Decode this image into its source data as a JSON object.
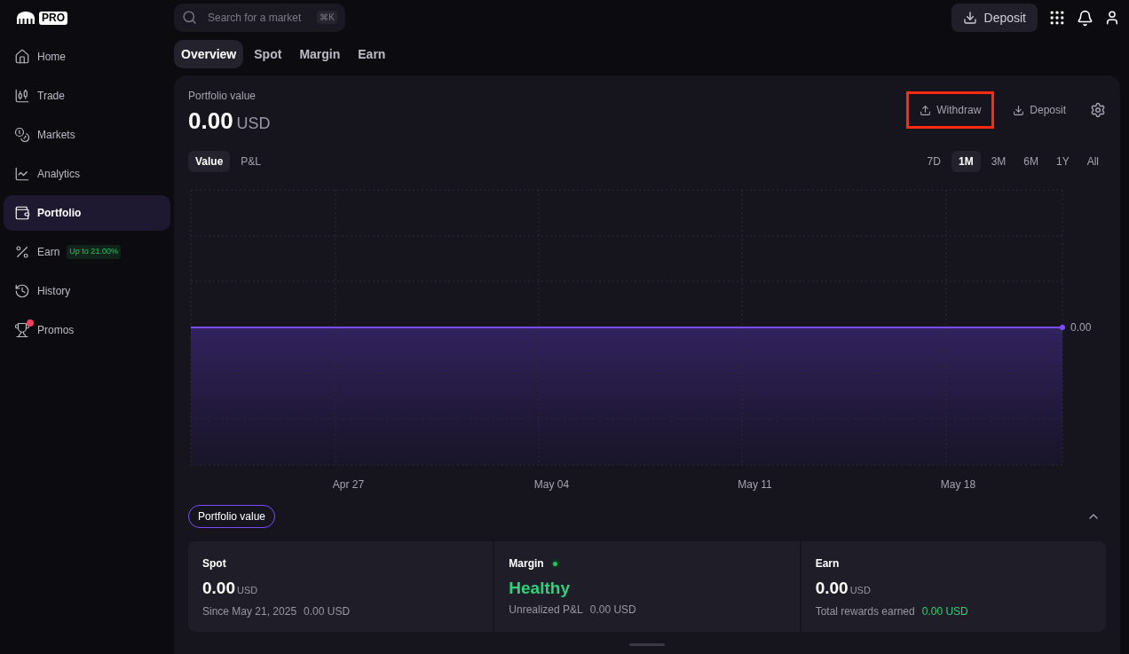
{
  "logo": {
    "badge": "PRO"
  },
  "sidebar": {
    "items": [
      {
        "label": "Home",
        "kind": "home",
        "selected": false,
        "notification": false
      },
      {
        "label": "Trade",
        "kind": "trade",
        "selected": false,
        "notification": false
      },
      {
        "label": "Markets",
        "kind": "markets",
        "selected": false,
        "notification": false
      },
      {
        "label": "Analytics",
        "kind": "analytics",
        "selected": false,
        "notification": false
      },
      {
        "label": "Portfolio",
        "kind": "portfolio",
        "selected": true,
        "notification": false
      },
      {
        "label": "Earn",
        "kind": "earn",
        "selected": false,
        "notification": false,
        "badge": "Up to 21.00%"
      },
      {
        "label": "History",
        "kind": "history",
        "selected": false,
        "notification": false
      },
      {
        "label": "Promos",
        "kind": "promos",
        "selected": false,
        "notification": true
      }
    ]
  },
  "topbar": {
    "search": {
      "placeholder": "Search for a market",
      "shortcut": "⌘K"
    },
    "deposit": "Deposit"
  },
  "tabs": [
    {
      "label": "Overview",
      "selected": true
    },
    {
      "label": "Spot",
      "selected": false
    },
    {
      "label": "Margin",
      "selected": false
    },
    {
      "label": "Earn",
      "selected": false
    }
  ],
  "portfolio": {
    "label": "Portfolio value",
    "amount": "0.00",
    "currency": "USD",
    "actions": [
      {
        "label": "Withdraw",
        "kind": "withdraw",
        "highlighted": true
      },
      {
        "label": "Deposit",
        "kind": "deposit",
        "highlighted": false
      }
    ]
  },
  "view_toggle": [
    {
      "label": "Value",
      "selected": true
    },
    {
      "label": "P&L",
      "selected": false
    }
  ],
  "ranges": [
    {
      "label": "7D",
      "selected": false
    },
    {
      "label": "1M",
      "selected": true
    },
    {
      "label": "3M",
      "selected": false
    },
    {
      "label": "6M",
      "selected": false
    },
    {
      "label": "1Y",
      "selected": false
    },
    {
      "label": "All",
      "selected": false
    }
  ],
  "chart": {
    "x_labels": [
      "Apr 27",
      "May 04",
      "May 11",
      "May 18"
    ],
    "last_value": "0.00"
  },
  "legend": {
    "label": "Portfolio value"
  },
  "cards": [
    {
      "kind": "balance",
      "title": "Spot",
      "amount": "0.00",
      "currency": "USD",
      "note": "Since May 21, 2025",
      "note_value": "0.00 USD",
      "accent": false
    },
    {
      "kind": "status",
      "title": "Margin",
      "status": "Healthy",
      "note": "Unrealized P&L",
      "note_value": "0.00 USD",
      "accent": false
    },
    {
      "kind": "balance",
      "title": "Earn",
      "amount": "0.00",
      "currency": "USD",
      "note": "Total rewards earned",
      "note_value": "0.00 USD",
      "accent": true
    }
  ]
}
